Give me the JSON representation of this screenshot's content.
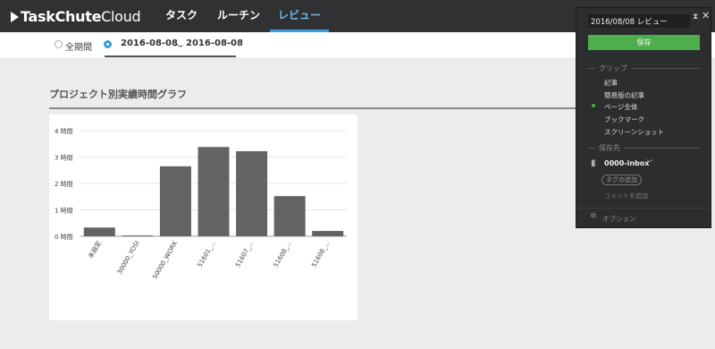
{
  "app": {
    "logo_bold": "TaskChute",
    "logo_light": "Cloud",
    "nav": [
      {
        "label": "タスク"
      },
      {
        "label": "ルーチン"
      },
      {
        "label": "レビュー"
      }
    ]
  },
  "period": {
    "all_label": "全期間",
    "start_date": "2016-08-08",
    "separator": "〜",
    "end_date": "2016-08-08"
  },
  "section_title": "プロジェクト別実績時間グラフ",
  "chart_data": {
    "type": "bar",
    "categories": [
      "未設定",
      "30000_YOSI",
      "50000_WORK",
      "51601_...",
      "51607_...",
      "51608_...",
      "51608_..."
    ],
    "values": [
      0.33,
      0.03,
      2.65,
      3.38,
      3.22,
      1.52,
      0.2
    ],
    "ylim": [
      0,
      4
    ],
    "yticks": [
      "0 時間",
      "1 時間",
      "2 時間",
      "3 時間",
      "4 時間"
    ],
    "grid": true,
    "bar_color": "#636363"
  },
  "clipper": {
    "title_value": "2016/08/08 レビュー",
    "save_label": "保存",
    "clip_heading": "クリップ",
    "clip_options": [
      "記事",
      "簡易版の記事",
      "ページ全体",
      "ブックマーク",
      "スクリーンショット"
    ],
    "selected_clip": "ページ全体",
    "dest_heading": "保存先",
    "notebook": "0000-inbox",
    "tag_label": "タグの追加",
    "comment_label": "コメントを追加",
    "options_label": "オプション",
    "accent": "#4fae4c"
  }
}
